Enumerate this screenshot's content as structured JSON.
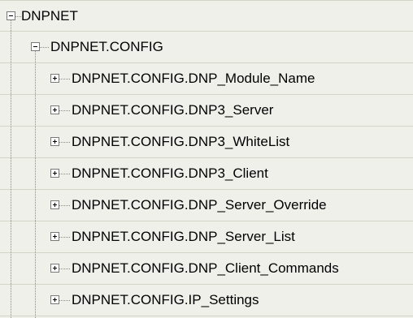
{
  "tree": {
    "root": {
      "label": "DNPNET",
      "expanded": true,
      "icon": "minus-box-icon"
    },
    "config": {
      "label": "DNPNET.CONFIG",
      "expanded": true,
      "icon": "minus-box-icon"
    },
    "children": [
      {
        "label": "DNPNET.CONFIG.DNP_Module_Name",
        "expanded": false,
        "icon": "plus-box-icon"
      },
      {
        "label": "DNPNET.CONFIG.DNP3_Server",
        "expanded": false,
        "icon": "plus-box-icon"
      },
      {
        "label": "DNPNET.CONFIG.DNP3_WhiteList",
        "expanded": false,
        "icon": "plus-box-icon"
      },
      {
        "label": "DNPNET.CONFIG.DNP3_Client",
        "expanded": false,
        "icon": "plus-box-icon"
      },
      {
        "label": "DNPNET.CONFIG.DNP_Server_Override",
        "expanded": false,
        "icon": "plus-box-icon"
      },
      {
        "label": "DNPNET.CONFIG.DNP_Server_List",
        "expanded": false,
        "icon": "plus-box-icon"
      },
      {
        "label": "DNPNET.CONFIG.DNP_Client_Commands",
        "expanded": false,
        "icon": "plus-box-icon"
      },
      {
        "label": "DNPNET.CONFIG.IP_Settings",
        "expanded": false,
        "icon": "plus-box-icon"
      }
    ]
  },
  "colors": {
    "background": "#f0f0ea",
    "row_border": "#d6d3c8",
    "tree_line": "#8a8a8a",
    "toggle_border": "#7a7a7a",
    "text": "#000000"
  }
}
